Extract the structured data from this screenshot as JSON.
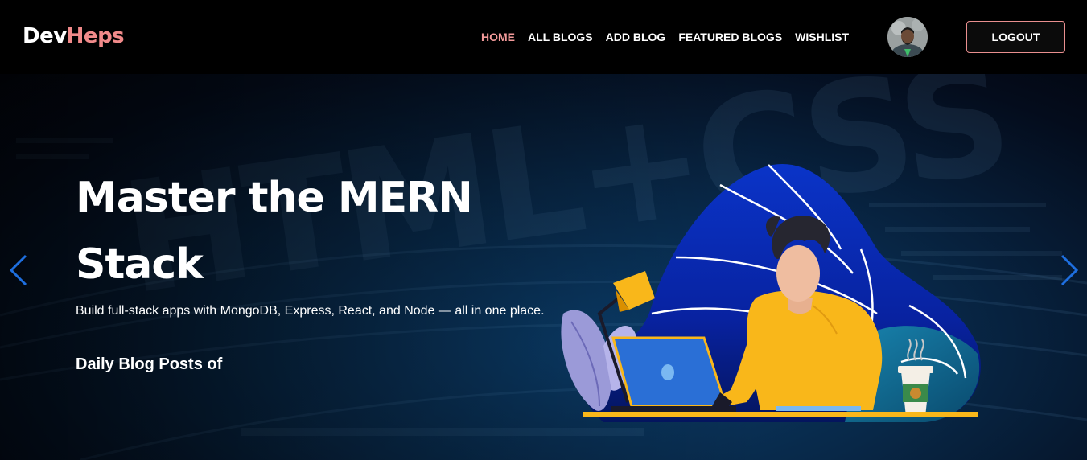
{
  "brand": {
    "part1": "Dev",
    "part2": "Heps"
  },
  "nav": {
    "items": [
      {
        "label": "HOME",
        "active": true
      },
      {
        "label": "ALL BLOGS",
        "active": false
      },
      {
        "label": "ADD BLOG",
        "active": false
      },
      {
        "label": "FEATURED BLOGS",
        "active": false
      },
      {
        "label": "WISHLIST",
        "active": false
      }
    ],
    "logout_label": "LOGOUT"
  },
  "hero": {
    "title": "Master the MERN Stack",
    "description": "Build full-stack apps with MongoDB, Express, React, and Node — all in one place.",
    "subtitle": "Daily Blog Posts of"
  },
  "colors": {
    "brand_accent": "#f18a8a",
    "active_nav": "#f39a9a",
    "logout_border": "#e98f8f",
    "blob_blue": "#0a2fbf",
    "shirt_yellow": "#f9b71a"
  },
  "icons": {
    "prev": "chevron-left-icon",
    "next": "chevron-right-icon"
  }
}
